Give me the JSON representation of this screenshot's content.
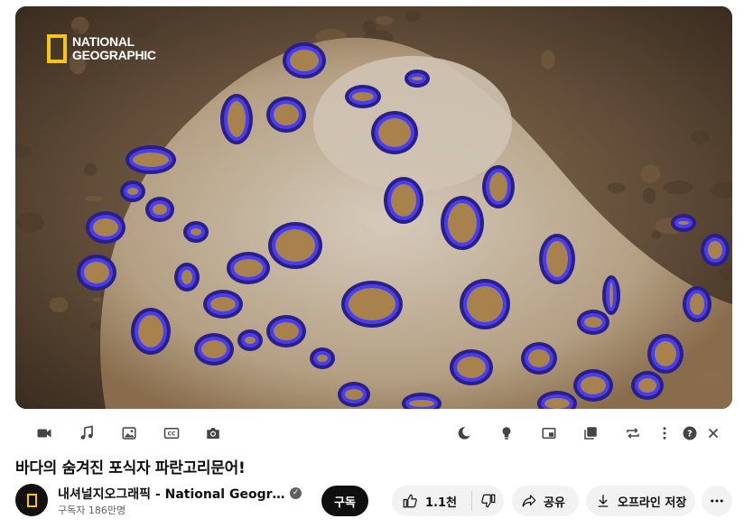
{
  "player": {
    "logo_text_line1": "NATIONAL",
    "logo_text_line2": "GEOGRAPHIC",
    "accent_color": "#f5c518"
  },
  "toolbar": {
    "left_icons": [
      "video-camera-icon",
      "music-note-icon",
      "image-icon",
      "closed-captions-icon",
      "camera-icon"
    ],
    "right_icons": [
      "moon-icon",
      "lightbulb-icon",
      "picture-in-picture-icon",
      "playlist-icon",
      "loop-icon",
      "more-vertical-icon",
      "help-icon",
      "close-icon"
    ]
  },
  "video": {
    "title": "바다의 숨겨진 포식자 파란고리문어!"
  },
  "channel": {
    "name": "내셔널지오그래픽 - National Geographic Korea",
    "subscribers": "구독자 186만명",
    "subscribe_label": "구독"
  },
  "actions": {
    "like_count": "1.1천",
    "share_label": "공유",
    "offline_label": "오프라인 저장"
  }
}
